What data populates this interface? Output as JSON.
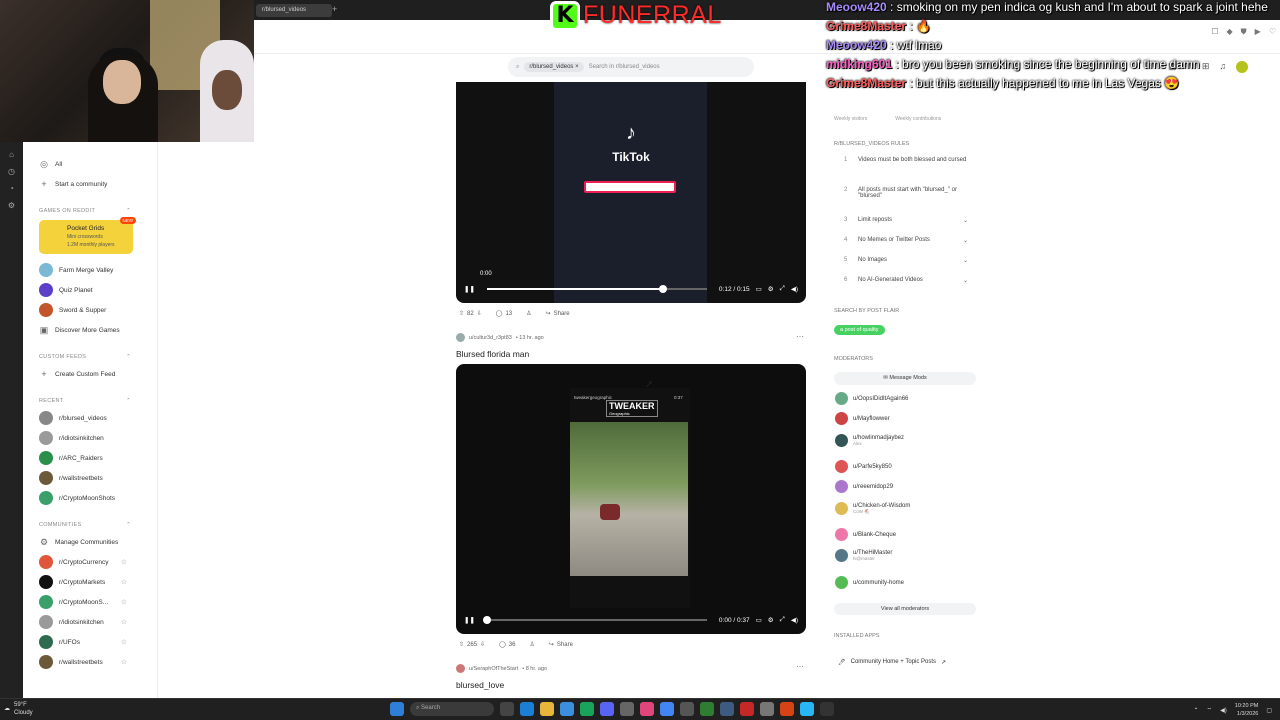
{
  "overlay": {
    "logo_letter": "K",
    "logo_text": "FUNERRAL",
    "chat": [
      {
        "user": "Meoow420",
        "user_color": "#a78bfa",
        "text": ": smoking on my pen indica og kush and I'm about to spark a joint hehe"
      },
      {
        "user": "Grime8Master",
        "user_color": "#ff5e5e",
        "text": ": 🔥"
      },
      {
        "user": "Meoow420",
        "user_color": "#a78bfa",
        "text": ": wtf lmao"
      },
      {
        "user": "midking601",
        "user_color": "#ff5ec8",
        "text": ": bro you been smoking since the beginning of time damn"
      },
      {
        "user": "Grime8Master",
        "user_color": "#ff5e5e",
        "text": ": but this actually happened to me in Las Vegas 😍"
      }
    ]
  },
  "browser": {
    "tab_title": "r/blursed_videos",
    "tab_plus": "+"
  },
  "search": {
    "chip": "r/blursed_videos",
    "chip_close": "×",
    "placeholder": "Search in r/blursed_videos"
  },
  "sidebar": {
    "top_items": [
      {
        "label": "All",
        "icon": "chart-icon"
      },
      {
        "label": "Start a community",
        "icon": "plus-icon"
      }
    ],
    "games_head": "GAMES ON REDDIT",
    "pocket": {
      "title": "Pocket Grids",
      "sub": "Mini crosswords",
      "players": "1.2M monthly players",
      "badge": "NEW"
    },
    "games": [
      "Farm Merge Valley",
      "Quiz Planet",
      "Sword & Supper",
      "Discover More Games"
    ],
    "custom_head": "CUSTOM FEEDS",
    "custom_item": "Create Custom Feed",
    "recent_head": "RECENT",
    "recent": [
      "r/blursed_videos",
      "r/idiotsinkitchen",
      "r/ARC_Raiders",
      "r/wallstreetbets",
      "r/CryptoMoonShots"
    ],
    "communities_head": "COMMUNITIES",
    "manage": "Manage Communities",
    "communities": [
      "r/CryptoCurrency",
      "r/CryptoMarkets",
      "r/CryptoMoonS...",
      "r/idiotsinkitchen",
      "r/UFOs",
      "r/wallstreetbets"
    ]
  },
  "feed": {
    "video1": {
      "brand": "TikTok",
      "hover_time": "0:00",
      "time": "0:12 / 0:15",
      "progress": 0.8,
      "upvotes": "82",
      "comments": "13",
      "share": "Share"
    },
    "post2": {
      "author": "u/cultur3d_r3pt83",
      "age": "• 13 hr. ago",
      "title": "Blursed florida man",
      "clip_label": "tweakergeographic",
      "clip_dur": "0:37",
      "overlay_title": "TWEAKER",
      "overlay_sub": "Geographic",
      "time": "0:00 / 0:37",
      "progress": 0.0,
      "upvotes": "265",
      "comments": "36",
      "share": "Share"
    },
    "post3": {
      "author": "u/SeraphOfTheStart",
      "age": "• 8 hr. ago",
      "title": "blursed_love"
    }
  },
  "right": {
    "stats": {
      "weekly_visitors": "Weekly visitors",
      "weekly_contrib": "Weekly contributions"
    },
    "rules_head": "R/BLURSED_VIDEOS RULES",
    "rules": [
      {
        "n": "1",
        "text": "Videos must be both blessed and cursed"
      },
      {
        "n": "2",
        "text": "All posts must start with \"blursed_\" or \"blursed\""
      },
      {
        "n": "3",
        "text": "Limit reposts"
      },
      {
        "n": "4",
        "text": "No Memes or Twitter Posts"
      },
      {
        "n": "5",
        "text": "No Images"
      },
      {
        "n": "6",
        "text": "No AI-Generated Videos"
      }
    ],
    "flair_head": "SEARCH BY POST FLAIR",
    "flair": "a post of quality",
    "mods_head": "MODERATORS",
    "message_mods": "Message Mods",
    "mods": [
      {
        "name": "u/OopsIDidItAgain66",
        "sub": ""
      },
      {
        "name": "u/Mayflowwer",
        "sub": ""
      },
      {
        "name": "u/howlinmadjaybez",
        "sub": "Alex"
      },
      {
        "name": "u/Parfe5ky850",
        "sub": ""
      },
      {
        "name": "u/reeemidop29",
        "sub": ""
      },
      {
        "name": "u/Chicken-of-Wisdom",
        "sub": "CoW 🐔"
      },
      {
        "name": "u/Blank-Cheque",
        "sub": ""
      },
      {
        "name": "u/TheHiMaster",
        "sub": "hi@master"
      },
      {
        "name": "u/community-home",
        "sub": ""
      }
    ],
    "view_all": "View all moderators",
    "apps_head": "INSTALLED APPS",
    "app": "Community Home + Topic Posts"
  },
  "taskbar": {
    "temp": "59°F",
    "weather": "Cloudy",
    "search": "Search",
    "time": "10:20 PM",
    "date": "1/3/2026"
  }
}
